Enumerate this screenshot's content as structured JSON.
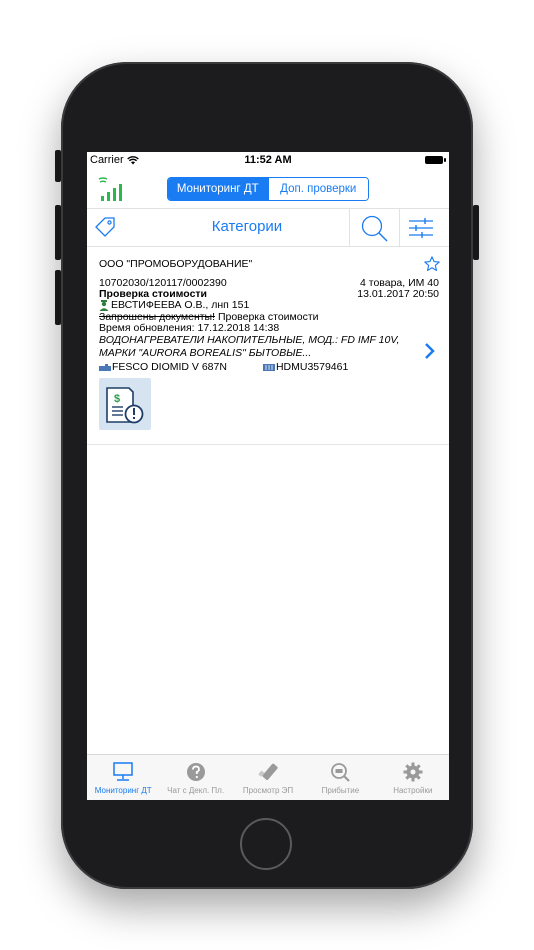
{
  "status": {
    "carrier": "Carrier",
    "time": "11:52 AM"
  },
  "nav": {
    "segments": [
      "Мониторинг ДТ",
      "Доп. проверки"
    ],
    "selected": 0
  },
  "category_bar": {
    "title": "Категории"
  },
  "card": {
    "company": "ООО \"ПРОМОБОРУДОВАНИЕ\"",
    "decl_number": "10702030/120117/0002390",
    "goods_info": "4 товара, ИМ 40",
    "check_type": "Проверка стоимости",
    "date": "13.01.2017 20:50",
    "inspector": "ЕВСТИФЕЕВА О.В., лнп 151",
    "docs_requested": "Запрошены документы!",
    "docs_check": "Проверка стоимости",
    "updated": "Время обновления: 17.12.2018 14:38",
    "description_line1": "ВОДОНАГРЕВАТЕЛИ НАКОПИТЕЛЬНЫЕ, МОД.: FD IMF 10V,",
    "description_line2": "МАРКИ \"AURORA BOREALIS\" БЫТОВЫЕ...",
    "vessel": "FESCO DIOMID V 687N",
    "container": "HDMU3579461"
  },
  "tabs": [
    {
      "label": "Мониторинг ДТ",
      "icon": "monitor-icon",
      "active": true
    },
    {
      "label": "Чат с Декл. Пл.",
      "icon": "question-icon",
      "active": false
    },
    {
      "label": "Просмотр ЭП",
      "icon": "usb-key-icon",
      "active": false
    },
    {
      "label": "Прибытие",
      "icon": "magnifier-icon",
      "active": false
    },
    {
      "label": "Настройки",
      "icon": "gear-icon",
      "active": false
    }
  ],
  "colors": {
    "accent": "#1a7cf2",
    "signal": "#2db84d",
    "tab_inactive": "#9a9a9a"
  }
}
